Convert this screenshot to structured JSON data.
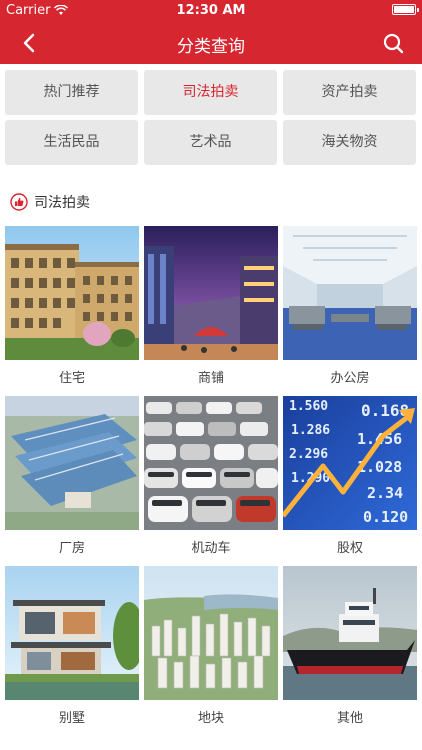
{
  "status": {
    "carrier": "Carrier",
    "time": "12:30 AM"
  },
  "nav": {
    "title": "分类查询",
    "back_icon": "chevron-left-icon",
    "search_icon": "search-icon"
  },
  "categories": [
    {
      "label": "热门推荐",
      "active": false
    },
    {
      "label": "司法拍卖",
      "active": true
    },
    {
      "label": "资产拍卖",
      "active": false
    },
    {
      "label": "生活民品",
      "active": false
    },
    {
      "label": "艺术品",
      "active": false
    },
    {
      "label": "海关物资",
      "active": false
    }
  ],
  "section": {
    "title": "司法拍卖",
    "icon": "thumbs-up-icon"
  },
  "items": [
    {
      "label": "住宅"
    },
    {
      "label": "商铺"
    },
    {
      "label": "办公房"
    },
    {
      "label": "厂房"
    },
    {
      "label": "机动车"
    },
    {
      "label": "股权",
      "tickers": [
        "1.560",
        "1.286",
        "2.296",
        "1.290",
        "0.168",
        "1.456",
        "1.028",
        "2.34",
        "0.120"
      ]
    },
    {
      "label": "别墅"
    },
    {
      "label": "地块"
    },
    {
      "label": "其他"
    }
  ],
  "colors": {
    "brand": "#d6262f",
    "button_bg": "#e8e8e8"
  }
}
